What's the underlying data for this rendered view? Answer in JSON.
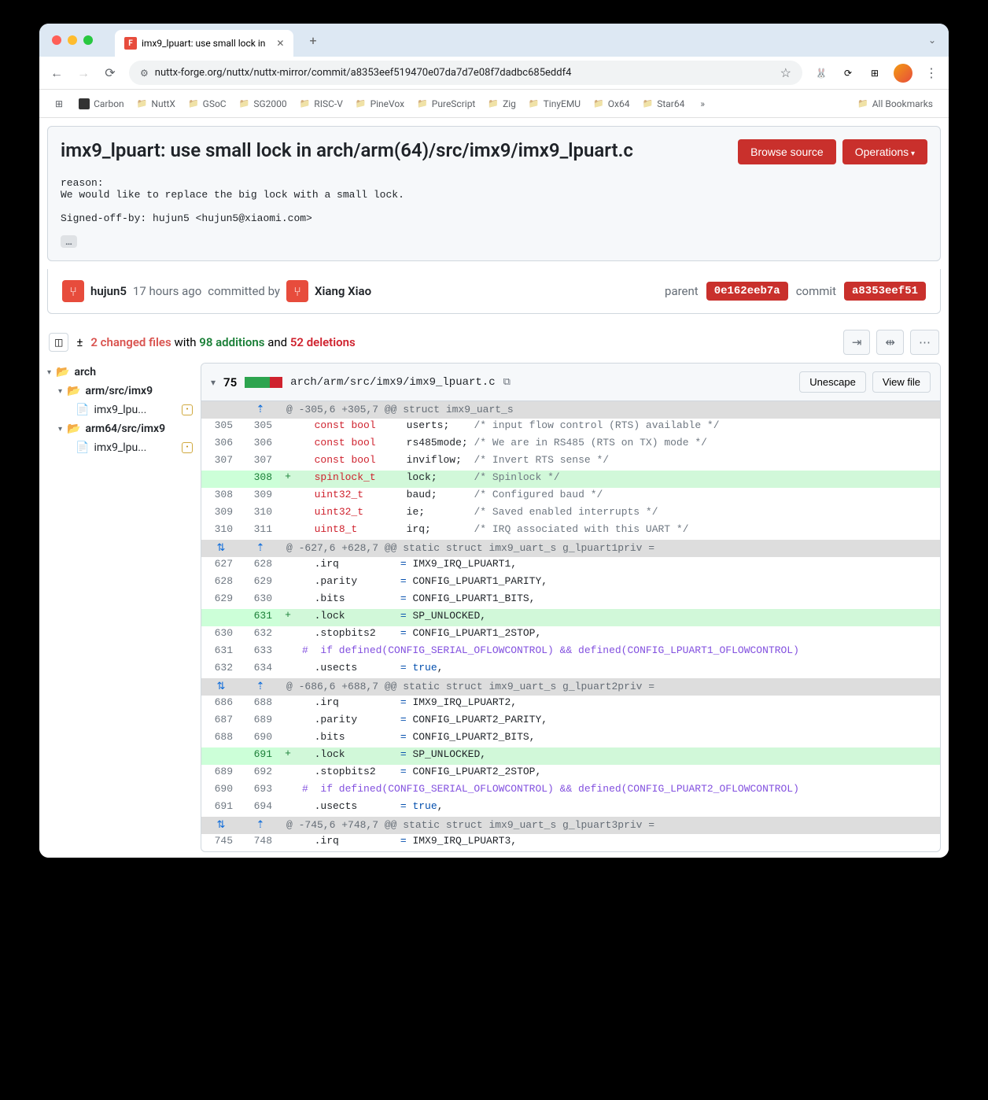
{
  "browser": {
    "tab_title": "imx9_lpuart: use small lock in",
    "url": "nuttx-forge.org/nuttx/nuttx-mirror/commit/a8353eef519470e07da7d7e08f7dadbc685eddf4",
    "bookmarks": [
      "Carbon",
      "NuttX",
      "GSoC",
      "SG2000",
      "RISC-V",
      "PineVox",
      "PureScript",
      "Zig",
      "TinyEMU",
      "Ox64",
      "Star64"
    ],
    "all_bookmarks": "All Bookmarks"
  },
  "commit": {
    "title": "imx9_lpuart: use small lock in arch/arm(64)/src/imx9/imx9_lpuart.c",
    "browse_source": "Browse source",
    "operations": "Operations",
    "message": "reason:\nWe would like to replace the big lock with a small lock.\n\nSigned-off-by: hujun5 <hujun5@xiaomi.com>",
    "author": "hujun5",
    "time": "17 hours ago",
    "committed_by": "committed by",
    "committer": "Xiang Xiao",
    "parent_label": "parent",
    "parent_sha": "0e162eeb7a",
    "commit_label": "commit",
    "commit_sha": "a8353eef51"
  },
  "stats": {
    "changed_files": "2 changed files",
    "with": " with ",
    "additions": "98 additions",
    "and": " and ",
    "deletions": "52 deletions"
  },
  "tree": {
    "arch": "arch",
    "arm": "arm/src/imx9",
    "arm_file": "imx9_lpu...",
    "arm64": "arm64/src/imx9",
    "arm64_file": "imx9_lpu..."
  },
  "file": {
    "count": "75",
    "path": "arch/arm/src/imx9/imx9_lpuart.c",
    "unescape": "Unescape",
    "view": "View file"
  },
  "hunks": [
    {
      "header": "@ -305,6 +305,7 @@ struct imx9_uart_s",
      "expand": "up",
      "rows": [
        {
          "l": "305",
          "r": "305",
          "s": " ",
          "code": "  <span class=\"kw-red\">const</span> <span class=\"kw-red\">bool</span>     userts;    <span class=\"cmt\">/* input flow control (RTS) available */</span>"
        },
        {
          "l": "306",
          "r": "306",
          "s": " ",
          "code": "  <span class=\"kw-red\">const</span> <span class=\"kw-red\">bool</span>     rs485mode; <span class=\"cmt\">/* We are in RS485 (RTS on TX) mode */</span>"
        },
        {
          "l": "307",
          "r": "307",
          "s": " ",
          "code": "  <span class=\"kw-red\">const</span> <span class=\"kw-red\">bool</span>     inviflow;  <span class=\"cmt\">/* Invert RTS sense */</span>"
        },
        {
          "l": "",
          "r": "308",
          "s": "+",
          "add": true,
          "code": "  <span class=\"kw-red\">spinlock_t</span>     lock;      <span class=\"cmt\">/* Spinlock */</span>"
        },
        {
          "l": "308",
          "r": "309",
          "s": " ",
          "code": "  <span class=\"kw-red\">uint32_t</span>       baud;      <span class=\"cmt\">/* Configured baud */</span>"
        },
        {
          "l": "309",
          "r": "310",
          "s": " ",
          "code": "  <span class=\"kw-red\">uint32_t</span>       ie;        <span class=\"cmt\">/* Saved enabled interrupts */</span>"
        },
        {
          "l": "310",
          "r": "311",
          "s": " ",
          "code": "  <span class=\"kw-red\">uint8_t</span>        irq;       <span class=\"cmt\">/* IRQ associated with this UART */</span>"
        }
      ]
    },
    {
      "header": "@ -627,6 +628,7 @@ static struct imx9_uart_s g_lpuart1priv =",
      "expand": "both",
      "rows": [
        {
          "l": "627",
          "r": "628",
          "s": " ",
          "code": "  .irq          <span class=\"kw-blue\">=</span> IMX9_IRQ_LPUART1,"
        },
        {
          "l": "628",
          "r": "629",
          "s": " ",
          "code": "  .parity       <span class=\"kw-blue\">=</span> CONFIG_LPUART1_PARITY,"
        },
        {
          "l": "629",
          "r": "630",
          "s": " ",
          "code": "  .bits         <span class=\"kw-blue\">=</span> CONFIG_LPUART1_BITS,"
        },
        {
          "l": "",
          "r": "631",
          "s": "+",
          "add": true,
          "code": "  .lock         <span class=\"kw-blue\">=</span> SP_UNLOCKED,"
        },
        {
          "l": "630",
          "r": "632",
          "s": " ",
          "code": "  .stopbits2    <span class=\"kw-blue\">=</span> CONFIG_LPUART1_2STOP,"
        },
        {
          "l": "631",
          "r": "633",
          "s": " ",
          "code": "<span class=\"kw-purple\">#  if defined(CONFIG_SERIAL_OFLOWCONTROL) && defined(CONFIG_LPUART1_OFLOWCONTROL)</span>"
        },
        {
          "l": "632",
          "r": "634",
          "s": " ",
          "code": "  .usects       <span class=\"kw-blue\">=</span> <span class=\"kw-blue\">true</span>,"
        }
      ]
    },
    {
      "header": "@ -686,6 +688,7 @@ static struct imx9_uart_s g_lpuart2priv =",
      "expand": "both",
      "rows": [
        {
          "l": "686",
          "r": "688",
          "s": " ",
          "code": "  .irq          <span class=\"kw-blue\">=</span> IMX9_IRQ_LPUART2,"
        },
        {
          "l": "687",
          "r": "689",
          "s": " ",
          "code": "  .parity       <span class=\"kw-blue\">=</span> CONFIG_LPUART2_PARITY,"
        },
        {
          "l": "688",
          "r": "690",
          "s": " ",
          "code": "  .bits         <span class=\"kw-blue\">=</span> CONFIG_LPUART2_BITS,"
        },
        {
          "l": "",
          "r": "691",
          "s": "+",
          "add": true,
          "code": "  .lock         <span class=\"kw-blue\">=</span> SP_UNLOCKED,"
        },
        {
          "l": "689",
          "r": "692",
          "s": " ",
          "code": "  .stopbits2    <span class=\"kw-blue\">=</span> CONFIG_LPUART2_2STOP,"
        },
        {
          "l": "690",
          "r": "693",
          "s": " ",
          "code": "<span class=\"kw-purple\">#  if defined(CONFIG_SERIAL_OFLOWCONTROL) && defined(CONFIG_LPUART2_OFLOWCONTROL)</span>"
        },
        {
          "l": "691",
          "r": "694",
          "s": " ",
          "code": "  .usects       <span class=\"kw-blue\">=</span> <span class=\"kw-blue\">true</span>,"
        }
      ]
    },
    {
      "header": "@ -745,6 +748,7 @@ static struct imx9_uart_s g_lpuart3priv =",
      "expand": "both",
      "rows": [
        {
          "l": "745",
          "r": "748",
          "s": " ",
          "code": "  .irq          <span class=\"kw-blue\">=</span> IMX9_IRQ_LPUART3,"
        }
      ]
    }
  ]
}
